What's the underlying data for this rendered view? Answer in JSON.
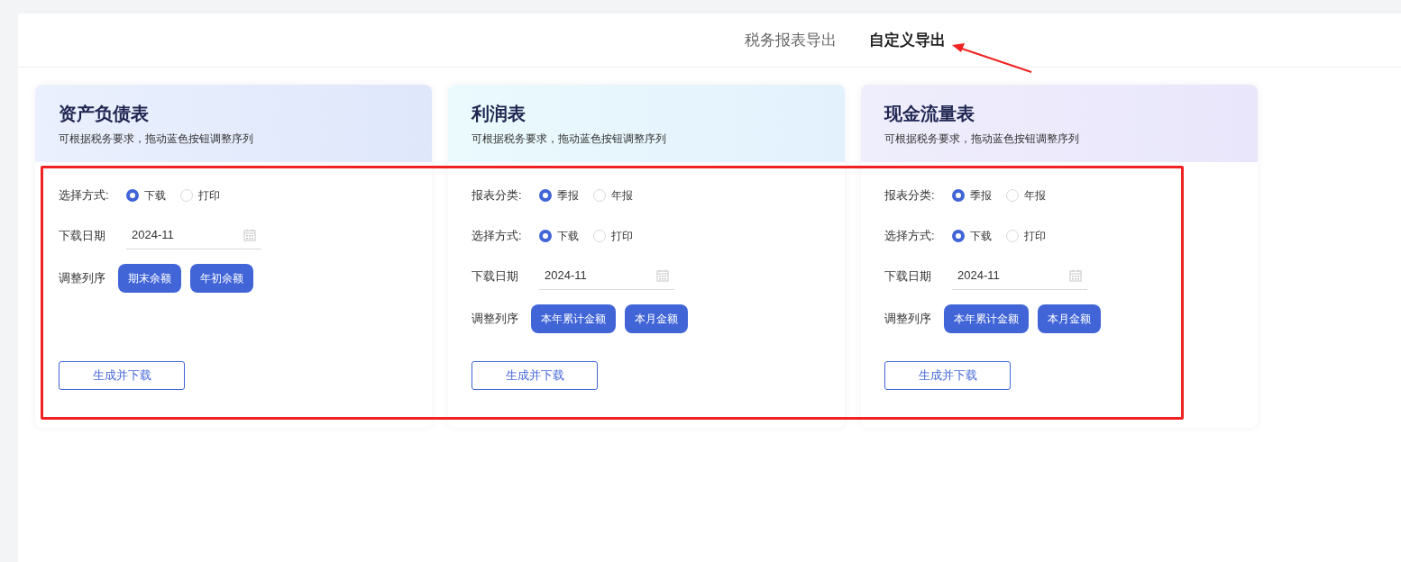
{
  "tabs": [
    {
      "label": "税务报表导出",
      "selected": false
    },
    {
      "label": "自定义导出",
      "selected": true
    }
  ],
  "cards": [
    {
      "title": "资产负债表",
      "subtitle": "可根据税务要求，拖动蓝色按钮调整序列",
      "fields": [
        {
          "kind": "radio",
          "label": "选择方式:",
          "options": [
            {
              "label": "下载",
              "selected": true
            },
            {
              "label": "打印",
              "selected": false
            }
          ]
        },
        {
          "kind": "date",
          "label": "下载日期",
          "value": "2024-11"
        },
        {
          "kind": "sort",
          "label": "调整列序",
          "chips": [
            "期末余额",
            "年初余额"
          ]
        }
      ],
      "action": "生成并下载"
    },
    {
      "title": "利润表",
      "subtitle": "可根据税务要求，拖动蓝色按钮调整序列",
      "fields": [
        {
          "kind": "radio",
          "label": "报表分类:",
          "options": [
            {
              "label": "季报",
              "selected": true
            },
            {
              "label": "年报",
              "selected": false
            }
          ]
        },
        {
          "kind": "radio",
          "label": "选择方式:",
          "options": [
            {
              "label": "下载",
              "selected": true
            },
            {
              "label": "打印",
              "selected": false
            }
          ]
        },
        {
          "kind": "date",
          "label": "下载日期",
          "value": "2024-11"
        },
        {
          "kind": "sort",
          "label": "调整列序",
          "chips": [
            "本年累计金额",
            "本月金额"
          ]
        }
      ],
      "action": "生成并下载"
    },
    {
      "title": "现金流量表",
      "subtitle": "可根据税务要求，拖动蓝色按钮调整序列",
      "fields": [
        {
          "kind": "radio",
          "label": "报表分类:",
          "options": [
            {
              "label": "季报",
              "selected": true
            },
            {
              "label": "年报",
              "selected": false
            }
          ]
        },
        {
          "kind": "radio",
          "label": "选择方式:",
          "options": [
            {
              "label": "下载",
              "selected": true
            },
            {
              "label": "打印",
              "selected": false
            }
          ]
        },
        {
          "kind": "date",
          "label": "下载日期",
          "value": "2024-11"
        },
        {
          "kind": "sort",
          "label": "调整列序",
          "chips": [
            "本年累计金额",
            "本月金额"
          ]
        }
      ],
      "action": "生成并下载"
    }
  ]
}
